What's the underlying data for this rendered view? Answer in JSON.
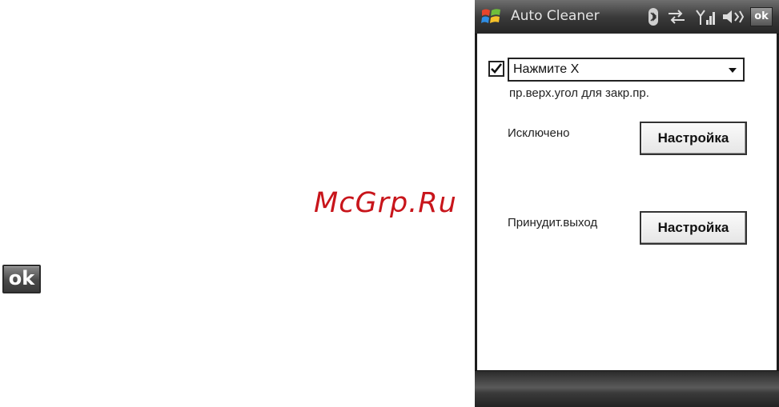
{
  "watermark": "McGrp.Ru",
  "left_key": {
    "label": "ok"
  },
  "title_bar": {
    "title": "Auto Cleaner",
    "ok_label": "ok",
    "icons": [
      "windows-start-icon",
      "bluetooth-icon",
      "sync-arrows-icon",
      "signal-strength-icon",
      "volume-icon"
    ]
  },
  "close_option": {
    "checked": true,
    "dropdown_value": "Нажмите X",
    "hint": "пр.верх.угол для закр.пр."
  },
  "exclusions": {
    "label": "Исключено",
    "button_label": "Настройка"
  },
  "force_exit": {
    "label": "Принудит.выход",
    "button_label": "Настройка"
  },
  "colors": {
    "watermark": "#c8151b",
    "title_bar": "#3b3b3b",
    "background": "#ffffff"
  }
}
